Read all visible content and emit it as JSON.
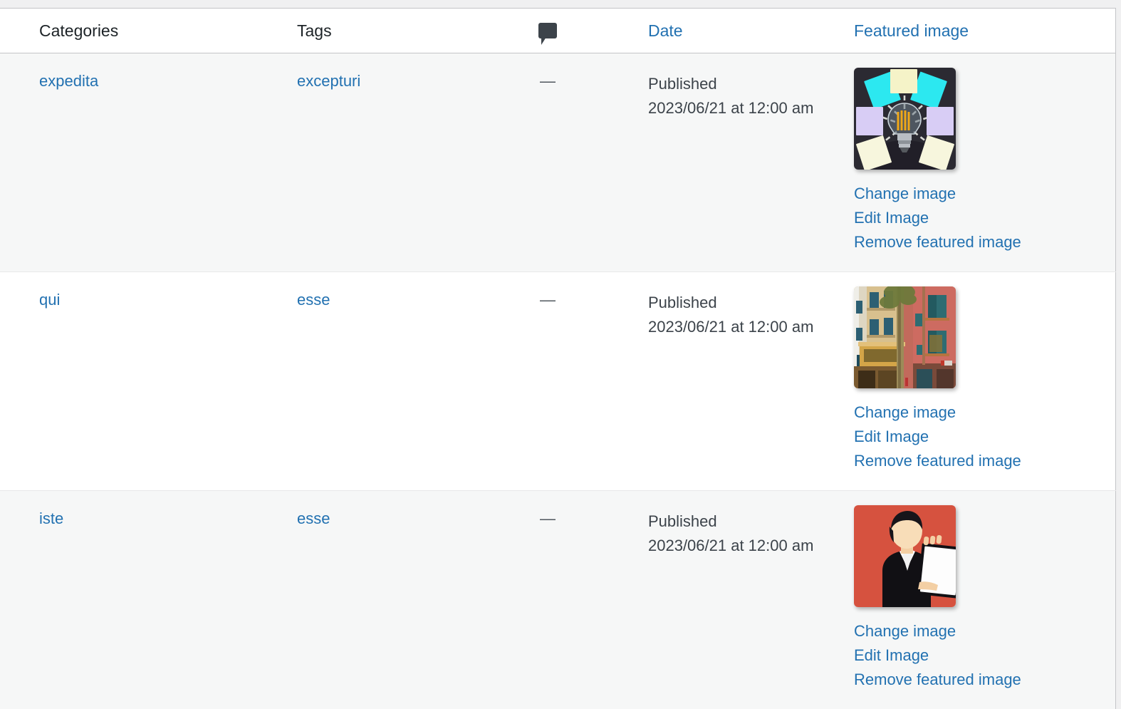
{
  "table": {
    "columns": [
      {
        "key": "categories",
        "label": "Categories",
        "icon": null,
        "is_link": false
      },
      {
        "key": "tags",
        "label": "Tags",
        "icon": null,
        "is_link": false
      },
      {
        "key": "comments",
        "label": "",
        "icon": "comment-icon",
        "is_link": true
      },
      {
        "key": "date",
        "label": "Date",
        "icon": null,
        "is_link": true
      },
      {
        "key": "featured_image",
        "label": "Featured image",
        "icon": null,
        "is_link": true
      }
    ],
    "rows": [
      {
        "categories": "expedita",
        "tags": "excepturi",
        "comments": "—",
        "date_status": "Published",
        "date_value": "2023/06/21 at 12:00 am",
        "thumbnail": "lightbulb-sticky-notes-thumbnail",
        "actions": [
          {
            "label": "Change image"
          },
          {
            "label": "Edit Image"
          },
          {
            "label": "Remove featured image"
          }
        ]
      },
      {
        "categories": "qui",
        "tags": "esse",
        "comments": "—",
        "date_status": "Published",
        "date_value": "2023/06/21 at 12:00 am",
        "thumbnail": "street-buildings-facade-thumbnail",
        "actions": [
          {
            "label": "Change image"
          },
          {
            "label": "Edit Image"
          },
          {
            "label": "Remove featured image"
          }
        ]
      },
      {
        "categories": "iste",
        "tags": "esse",
        "comments": "—",
        "date_status": "Published",
        "date_value": "2023/06/21 at 12:00 am",
        "thumbnail": "person-holding-board-illustration-thumbnail",
        "actions": [
          {
            "label": "Change image"
          },
          {
            "label": "Edit Image"
          },
          {
            "label": "Remove featured image"
          }
        ]
      }
    ]
  },
  "colors": {
    "link": "#2271b1",
    "text": "#1d2327",
    "muted_text": "#3c434a",
    "row_alt_bg": "#f6f7f7",
    "row_bg": "#ffffff",
    "page_bg": "#f0f0f1",
    "border": "#c3c4c7",
    "comment_icon": "#3c434a"
  }
}
